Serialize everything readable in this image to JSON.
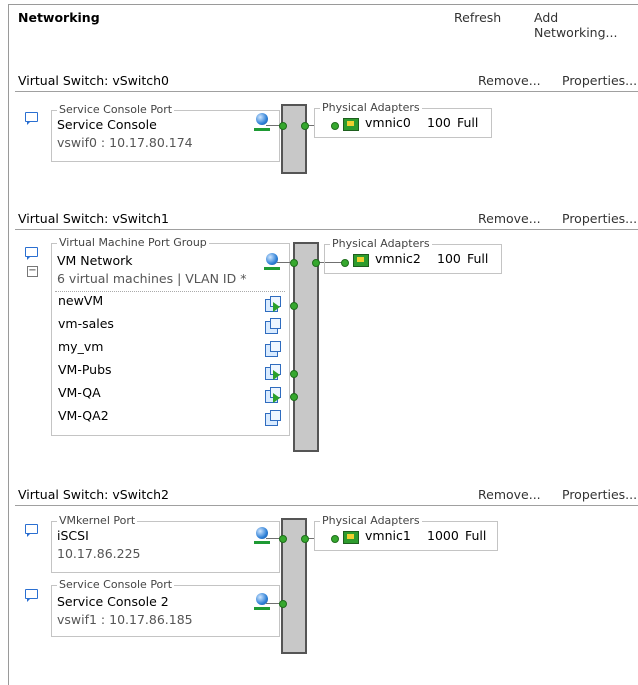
{
  "header": {
    "title": "Networking",
    "refresh": "Refresh",
    "add_networking": "Add Networking..."
  },
  "switches": [
    {
      "title": "Virtual Switch: vSwitch0",
      "remove": "Remove...",
      "properties": "Properties...",
      "ports": [
        {
          "legend": "Service Console Port",
          "name": "Service Console",
          "sub": "vswif0 : 10.17.80.174"
        }
      ],
      "adapters": {
        "legend": "Physical Adapters",
        "nic": "vmnic0",
        "speed": "100",
        "duplex": "Full"
      }
    },
    {
      "title": "Virtual Switch: vSwitch1",
      "remove": "Remove...",
      "properties": "Properties...",
      "ports": [
        {
          "legend": "Virtual Machine Port Group",
          "name": "VM Network",
          "sub": "6 virtual machines | VLAN ID *",
          "vms": [
            {
              "name": "newVM",
              "state": "powered-on"
            },
            {
              "name": "vm-sales",
              "state": "powered-off"
            },
            {
              "name": "my_vm",
              "state": "powered-off"
            },
            {
              "name": "VM-Pubs",
              "state": "powered-on"
            },
            {
              "name": "VM-QA",
              "state": "powered-on"
            },
            {
              "name": "VM-QA2",
              "state": "powered-off"
            }
          ]
        }
      ],
      "adapters": {
        "legend": "Physical Adapters",
        "nic": "vmnic2",
        "speed": "100",
        "duplex": "Full"
      }
    },
    {
      "title": "Virtual Switch: vSwitch2",
      "remove": "Remove...",
      "properties": "Properties...",
      "ports": [
        {
          "legend": "VMkernel Port",
          "name": "iSCSI",
          "sub": "10.17.86.225"
        },
        {
          "legend": "Service Console Port",
          "name": "Service Console 2",
          "sub": "vswif1 : 10.17.86.185"
        }
      ],
      "adapters": {
        "legend": "Physical Adapters",
        "nic": "vmnic1",
        "speed": "1000",
        "duplex": "Full"
      }
    }
  ],
  "colors": {
    "link_dot": "#36a82e",
    "bubble": "#2a6fd1",
    "switch_bar": "#c8c8c8"
  }
}
